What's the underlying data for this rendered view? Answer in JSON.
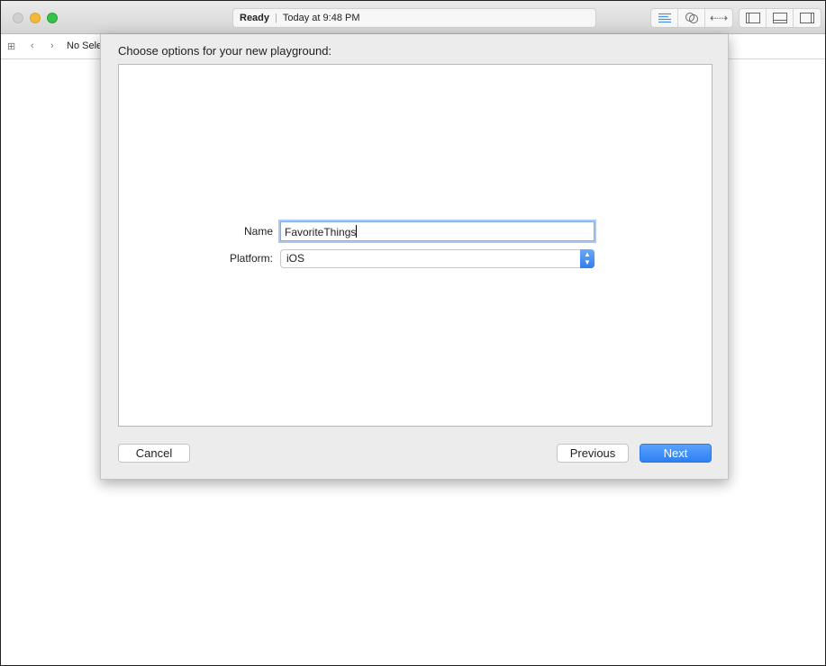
{
  "window": {
    "status": {
      "state": "Ready",
      "time": "Today at 9:48 PM"
    },
    "traffic_lights": {
      "close": "#cfcfcf",
      "minimize": "#f5b93a",
      "zoom": "#36c24a"
    },
    "toolbar_icons": [
      "standard-editor-icon",
      "assistant-editor-icon",
      "version-editor-icon",
      "navigator-panel-icon",
      "debug-panel-icon",
      "utilities-panel-icon"
    ],
    "navbar": {
      "breadcrumb": "No Sele"
    }
  },
  "sheet": {
    "title": "Choose options for your new playground:",
    "name_label": "Name",
    "name_value": "FavoriteThings",
    "platform_label": "Platform:",
    "platform_value": "iOS",
    "cancel": "Cancel",
    "previous": "Previous",
    "next": "Next",
    "accent": "#3d8ef7"
  }
}
